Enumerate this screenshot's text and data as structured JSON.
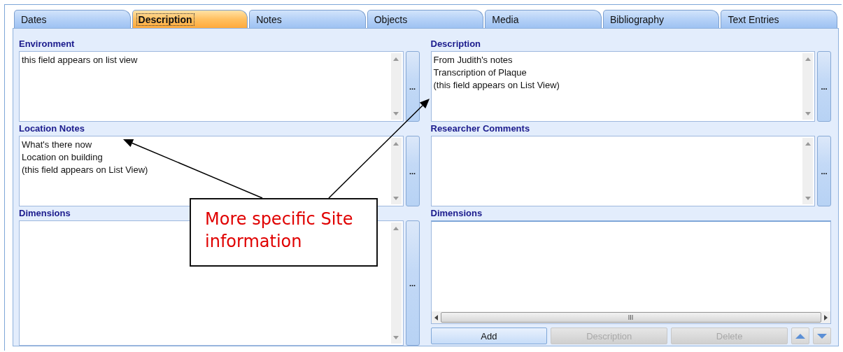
{
  "tabs": [
    {
      "label": "Dates",
      "selected": false
    },
    {
      "label": "Description",
      "selected": true
    },
    {
      "label": "Notes",
      "selected": false
    },
    {
      "label": "Objects",
      "selected": false
    },
    {
      "label": "Media",
      "selected": false
    },
    {
      "label": "Bibliography",
      "selected": false
    },
    {
      "label": "Text Entries",
      "selected": false
    }
  ],
  "left_fields": [
    {
      "kind": "text",
      "label": "Environment",
      "lines": [
        "this field appears on list view"
      ],
      "more_button": "..."
    },
    {
      "kind": "text",
      "label": "Location Notes",
      "lines": [
        "What's there now",
        "Location on building",
        "(this field appears on List View)"
      ],
      "more_button": "..."
    },
    {
      "kind": "text",
      "label": "Dimensions",
      "more_button": "..."
    }
  ],
  "right_fields": [
    {
      "kind": "text",
      "label": "Description",
      "lines": [
        "From Judith's notes",
        "Transcription of Plaque",
        "(this field appears on List View)"
      ],
      "more_button": "..."
    },
    {
      "kind": "text",
      "label": "Researcher Comments",
      "more_button": "..."
    },
    {
      "kind": "list",
      "label": "Dimensions",
      "buttons": [
        {
          "label": "Add",
          "disabled": false
        },
        {
          "label": "Description",
          "disabled": true
        },
        {
          "label": "Delete",
          "disabled": true
        }
      ]
    }
  ],
  "callout": {
    "text": "More specific Site information"
  }
}
